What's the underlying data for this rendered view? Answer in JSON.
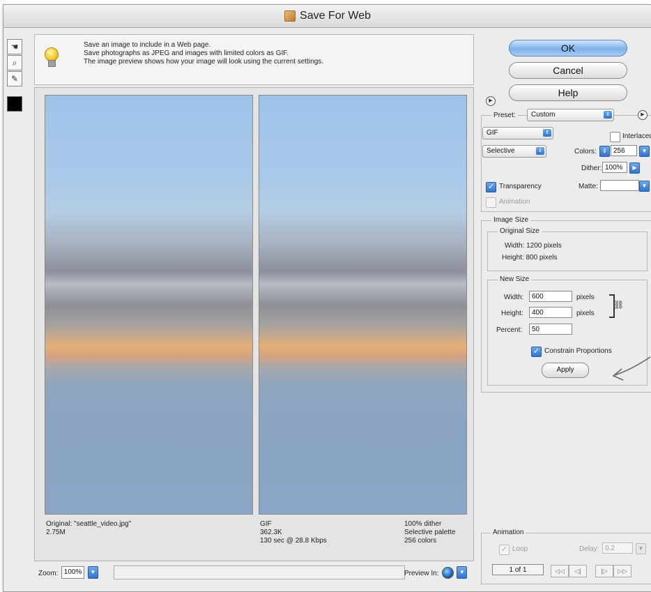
{
  "window": {
    "title": "Save For Web"
  },
  "tools": [
    {
      "name": "hand-tool-icon",
      "glyph": "☚"
    },
    {
      "name": "zoom-tool-icon",
      "glyph": "⌕"
    },
    {
      "name": "eyedropper-tool-icon",
      "glyph": "✎"
    }
  ],
  "info": {
    "line1": "Save an image to include in a Web page.",
    "line2": "Save photographs as JPEG and images with limited colors as GIF.",
    "line3": "The image preview shows how your image will look using the current settings."
  },
  "original_caption": {
    "line1": "Original: \"seattle_video.jpg\"",
    "line2": "2.75M"
  },
  "optimized_caption": {
    "left1": "GIF",
    "left2": "362.3K",
    "left3": "130 sec @ 28.8 Kbps",
    "right1": "100% dither",
    "right2": "Selective palette",
    "right3": "256 colors"
  },
  "zoom": {
    "label": "Zoom:",
    "value": "100%"
  },
  "preview_in": {
    "label": "Preview In:"
  },
  "buttons": {
    "ok": "OK",
    "cancel": "Cancel",
    "help": "Help",
    "apply": "Apply"
  },
  "settings": {
    "preset_label": "Preset:",
    "preset_value": "Custom",
    "format": "GIF",
    "reduction": "Selective",
    "interlaced_label": "Interlaced",
    "colors_label": "Colors:",
    "colors_value": "256",
    "dither_label": "Dither:",
    "dither_value": "100%",
    "transparency_label": "Transparency",
    "matte_label": "Matte:",
    "animation_label": "Animation"
  },
  "image_size": {
    "title": "Image Size",
    "original_title": "Original Size",
    "orig_width": "Width:  1200 pixels",
    "orig_height": "Height:  800 pixels",
    "new_title": "New Size",
    "width_label": "Width:",
    "width_value": "600",
    "height_label": "Height:",
    "height_value": "400",
    "percent_label": "Percent:",
    "percent_value": "50",
    "pixels1": "pixels",
    "pixels2": "pixels",
    "constrain_label": "Constrain Proportions"
  },
  "animation_panel": {
    "title": "Animation",
    "loop_label": "Loop",
    "delay_label": "Delay:",
    "delay_value": "0.2",
    "frame_counter": "1 of 1"
  }
}
